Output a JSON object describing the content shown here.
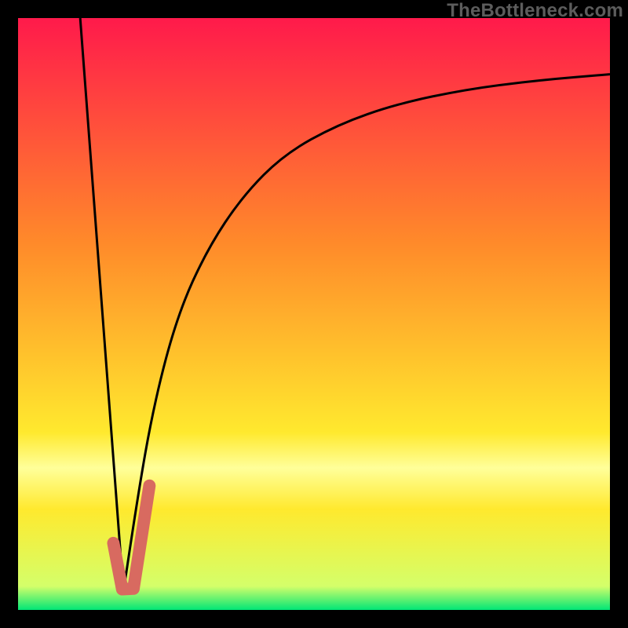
{
  "watermark": "TheBottleneck.com",
  "colors": {
    "frame": "#000000",
    "gradient_top": "#ff1a4b",
    "gradient_mid1": "#ff8a2a",
    "gradient_mid2": "#ffe92e",
    "gradient_band": "#ffff9a",
    "gradient_bottom": "#00e676",
    "curve": "#000000",
    "marker": "#d86a60"
  },
  "chart_data": {
    "type": "line",
    "title": "",
    "xlabel": "",
    "ylabel": "",
    "xlim": [
      0,
      100
    ],
    "ylim": [
      0,
      100
    ],
    "series": [
      {
        "name": "left-edge",
        "x": [
          10.5,
          17.8
        ],
        "y": [
          100,
          3
        ]
      },
      {
        "name": "right-curve",
        "x": [
          17.8,
          20,
          23,
          27,
          32,
          38,
          45,
          54,
          64,
          76,
          88,
          100
        ],
        "y": [
          3,
          18,
          35,
          50,
          61,
          70,
          77,
          82,
          85.5,
          88,
          89.5,
          90.5
        ]
      }
    ],
    "marker": {
      "name": "j-marker",
      "type": "polyline",
      "stroke_width_pct": 2.1,
      "points_xy": [
        [
          16.1,
          11.3
        ],
        [
          17.6,
          3.5
        ],
        [
          19.5,
          3.6
        ],
        [
          22.2,
          21.0
        ]
      ]
    },
    "gradient_stops": [
      {
        "pct": 0,
        "role": "top"
      },
      {
        "pct": 38,
        "role": "mid1"
      },
      {
        "pct": 70,
        "role": "mid2"
      },
      {
        "pct": 76,
        "role": "band"
      },
      {
        "pct": 83,
        "role": "mid2"
      },
      {
        "pct": 96,
        "role": "near-bottom"
      },
      {
        "pct": 100,
        "role": "bottom"
      }
    ]
  }
}
